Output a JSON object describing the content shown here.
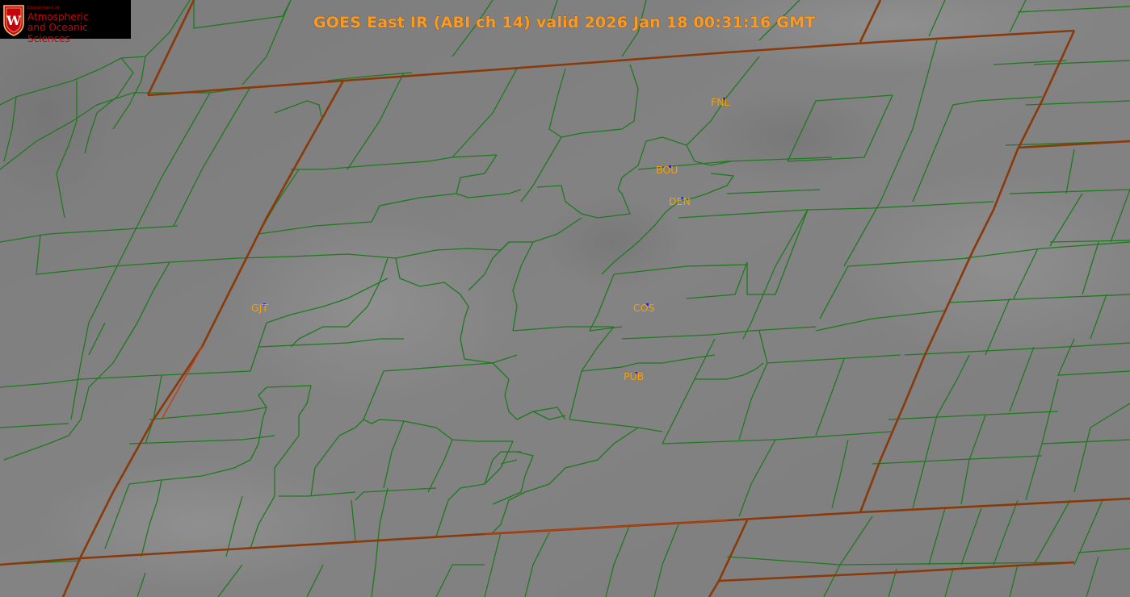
{
  "logo": {
    "department": "Department of",
    "line1": "Atmospheric",
    "line2": "and Oceanic Sciences",
    "seal_letter": "W"
  },
  "title": "GOES East IR (ABI ch 14) valid 2026 Jan 18 00:31:16 GMT",
  "stations": [
    {
      "id": "FNL",
      "label": "FNL"
    },
    {
      "id": "BOU",
      "label": "BOU"
    },
    {
      "id": "DEN",
      "label": "DEN"
    },
    {
      "id": "GJT",
      "label": "GJT"
    },
    {
      "id": "COS",
      "label": "COS"
    },
    {
      "id": "PUB",
      "label": "PUB"
    }
  ],
  "colors": {
    "county_lines": "#1e7a1e",
    "state_lines": "#8a3a0a",
    "state_lines_highlight": "#c04010",
    "station_label": "#f5a000",
    "station_marker": "#1e1ee6",
    "title": "#ff9a1f",
    "logo_text": "#c5050c"
  }
}
